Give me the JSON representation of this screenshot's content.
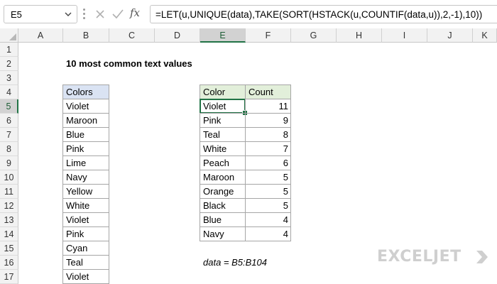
{
  "formula_bar": {
    "name_box": "E5",
    "cancel_icon": "x-icon",
    "enter_icon": "check-icon",
    "fx_label": "fx",
    "formula": "=LET(u,UNIQUE(data),TAKE(SORT(HSTACK(u,COUNTIF(data,u)),2,-1),10))"
  },
  "columns": [
    "A",
    "B",
    "C",
    "D",
    "E",
    "F",
    "G",
    "H",
    "I",
    "J",
    "K"
  ],
  "rows": [
    "1",
    "2",
    "3",
    "4",
    "5",
    "6",
    "7",
    "8",
    "9",
    "10",
    "11",
    "12",
    "13",
    "14",
    "15",
    "16",
    "17"
  ],
  "sheet": {
    "title": "10 most common text values",
    "colors_header": "Colors",
    "colors": [
      "Violet",
      "Maroon",
      "Blue",
      "Pink",
      "Lime",
      "Navy",
      "Yellow",
      "White",
      "Violet",
      "Pink",
      "Cyan",
      "Teal",
      "Violet"
    ],
    "result_headers": {
      "color": "Color",
      "count": "Count"
    },
    "results": [
      {
        "color": "Violet",
        "count": "11"
      },
      {
        "color": "Pink",
        "count": "9"
      },
      {
        "color": "Teal",
        "count": "8"
      },
      {
        "color": "White",
        "count": "7"
      },
      {
        "color": "Peach",
        "count": "6"
      },
      {
        "color": "Maroon",
        "count": "5"
      },
      {
        "color": "Orange",
        "count": "5"
      },
      {
        "color": "Black",
        "count": "5"
      },
      {
        "color": "Blue",
        "count": "4"
      },
      {
        "color": "Navy",
        "count": "4"
      }
    ],
    "note": "data = B5:B104"
  },
  "brand": {
    "logo_text": "EXCELJET"
  },
  "colors_theme": {
    "accent": "#217346",
    "header_blue": "#dae3f3",
    "header_green": "#e2efda"
  }
}
